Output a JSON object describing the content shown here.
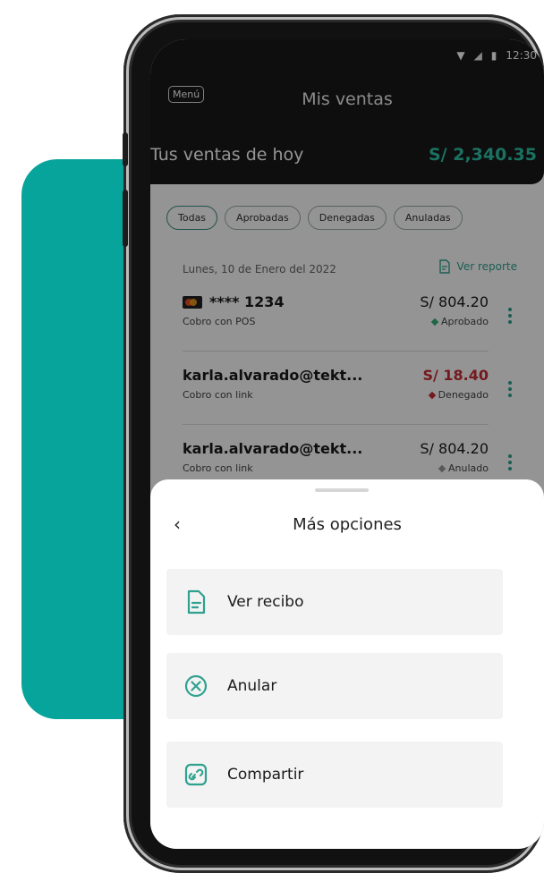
{
  "status_bar": {
    "time": "12:30"
  },
  "header": {
    "menu_label": "Menú",
    "title": "Mis ventas"
  },
  "sales_today": {
    "label": "Tus ventas de hoy",
    "amount": "S/ 2,340.35"
  },
  "filters": [
    "Todas",
    "Aprobadas",
    "Denegadas",
    "Anuladas"
  ],
  "date_line": "Lunes, 10 de Enero del 2022",
  "report_link": "Ver reporte",
  "transactions": [
    {
      "who": "**** 1234",
      "amount": "S/ 804.20",
      "method": "Cobro con POS",
      "status": "Aprobado",
      "status_color": "#38b27a"
    },
    {
      "who": "karla.alvarado@tekt...",
      "amount": "S/ 18.40",
      "method": "Cobro con link",
      "status": "Denegado",
      "status_color": "#c82b36"
    },
    {
      "who": "karla.alvarado@tekt...",
      "amount": "S/ 804.20",
      "method": "Cobro con link",
      "status": "Anulado",
      "status_color": "#999999"
    }
  ],
  "sheet": {
    "title": "Más opciones",
    "back_icon": "chevron-left-icon",
    "options": [
      {
        "label": "Ver recibo",
        "icon": "receipt-icon"
      },
      {
        "label": "Anular",
        "icon": "cancel-circle-icon"
      },
      {
        "label": "Compartir",
        "icon": "share-link-icon"
      }
    ]
  },
  "colors": {
    "accent": "#2fa18f",
    "teal_background": "#07a49c",
    "header": "#191919"
  }
}
